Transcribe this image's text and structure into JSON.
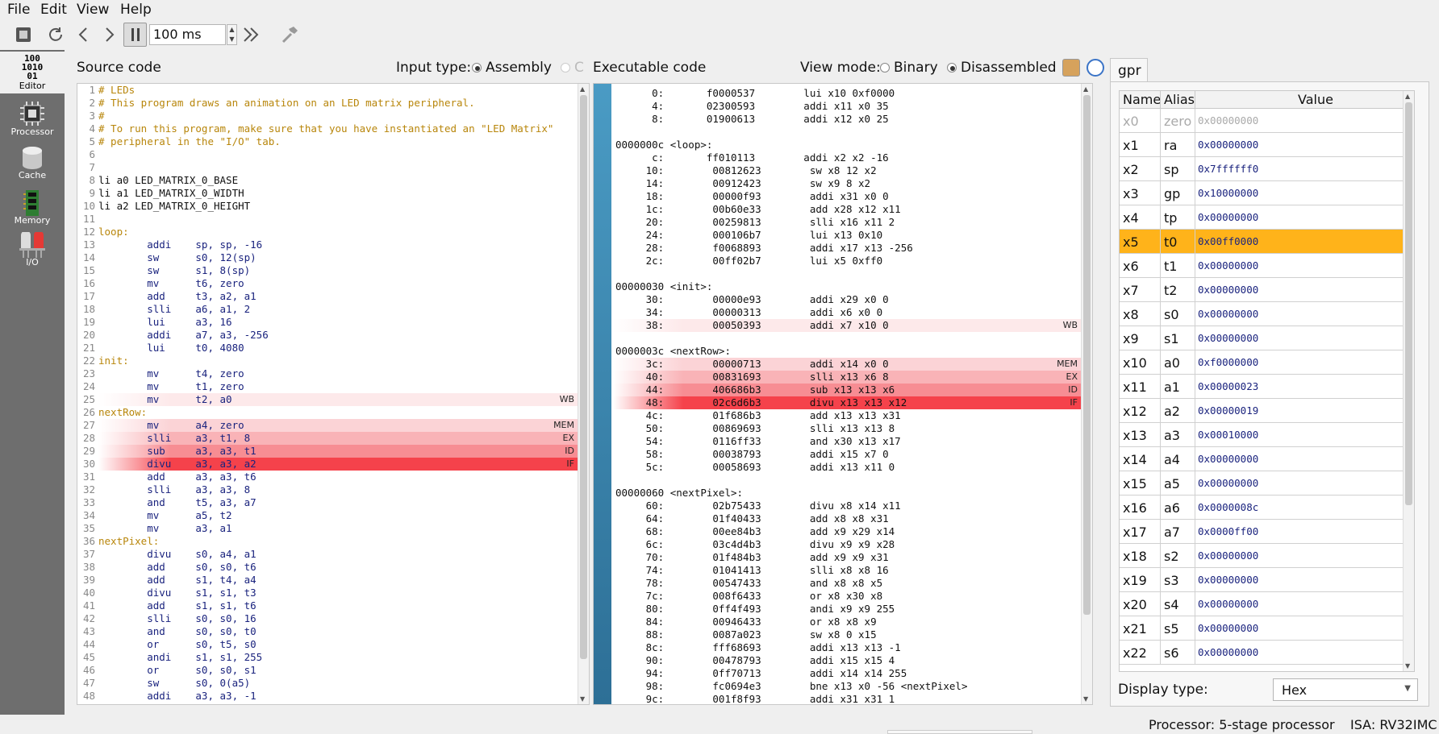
{
  "menu": [
    "File",
    "Edit",
    "View",
    "Help"
  ],
  "toolbar": {
    "speed": "100 ms"
  },
  "dock": [
    {
      "label": "Editor",
      "icon": "editor-binary-icon",
      "glyph": "100\n1010\n01"
    },
    {
      "label": "Processor",
      "icon": "processor-chip-icon"
    },
    {
      "label": "Cache",
      "icon": "cache-disk-icon"
    },
    {
      "label": "Memory",
      "icon": "memory-stick-icon"
    },
    {
      "label": "I/O",
      "icon": "io-led-icon"
    }
  ],
  "source": {
    "title": "Source code",
    "input_type_label": "Input type:",
    "opt_assembly": "Assembly",
    "opt_c": "C",
    "lines": [
      {
        "n": "1",
        "t": "# LEDs",
        "k": "comment"
      },
      {
        "n": "2",
        "t": "# This program draws an animation on an LED matrix peripheral.",
        "k": "comment"
      },
      {
        "n": "3",
        "t": "#",
        "k": "comment"
      },
      {
        "n": "4",
        "t": "# To run this program, make sure that you have instantiated an \"LED Matrix\"",
        "k": "comment"
      },
      {
        "n": "5",
        "t": "# peripheral in the \"I/O\" tab.",
        "k": "comment"
      },
      {
        "n": "6",
        "t": "",
        "k": ""
      },
      {
        "n": "7",
        "t": "",
        "k": ""
      },
      {
        "n": "8",
        "t": "li a0 LED_MATRIX_0_BASE",
        "k": "plain"
      },
      {
        "n": "9",
        "t": "li a1 LED_MATRIX_0_WIDTH",
        "k": "plain"
      },
      {
        "n": "10",
        "t": "li a2 LED_MATRIX_0_HEIGHT",
        "k": "plain"
      },
      {
        "n": "11",
        "t": "",
        "k": ""
      },
      {
        "n": "12",
        "t": "loop:",
        "k": "label"
      },
      {
        "n": "13",
        "t": "        addi    sp, sp, -16",
        "k": "instr"
      },
      {
        "n": "14",
        "t": "        sw      s0, 12(sp)",
        "k": "instr"
      },
      {
        "n": "15",
        "t": "        sw      s1, 8(sp)",
        "k": "instr"
      },
      {
        "n": "16",
        "t": "        mv      t6, zero",
        "k": "instr"
      },
      {
        "n": "17",
        "t": "        add     t3, a2, a1",
        "k": "instr"
      },
      {
        "n": "18",
        "t": "        slli    a6, a1, 2",
        "k": "instr"
      },
      {
        "n": "19",
        "t": "        lui     a3, 16",
        "k": "instr"
      },
      {
        "n": "20",
        "t": "        addi    a7, a3, -256",
        "k": "instr"
      },
      {
        "n": "21",
        "t": "        lui     t0, 4080",
        "k": "instr"
      },
      {
        "n": "22",
        "t": "init:",
        "k": "label"
      },
      {
        "n": "23",
        "t": "        mv      t4, zero",
        "k": "instr"
      },
      {
        "n": "24",
        "t": "        mv      t1, zero",
        "k": "instr"
      },
      {
        "n": "25",
        "t": "        mv      t2, a0",
        "k": "instr",
        "stage": "WB"
      },
      {
        "n": "26",
        "t": "nextRow:",
        "k": "label"
      },
      {
        "n": "27",
        "t": "        mv      a4, zero",
        "k": "instr",
        "stage": "MEM"
      },
      {
        "n": "28",
        "t": "        slli    a3, t1, 8",
        "k": "instr",
        "stage": "EX"
      },
      {
        "n": "29",
        "t": "        sub     a3, a3, t1",
        "k": "instr",
        "stage": "ID"
      },
      {
        "n": "30",
        "t": "        divu    a3, a3, a2",
        "k": "instr",
        "stage": "IF"
      },
      {
        "n": "31",
        "t": "        add     a3, a3, t6",
        "k": "instr"
      },
      {
        "n": "32",
        "t": "        slli    a3, a3, 8",
        "k": "instr"
      },
      {
        "n": "33",
        "t": "        and     t5, a3, a7",
        "k": "instr"
      },
      {
        "n": "34",
        "t": "        mv      a5, t2",
        "k": "instr"
      },
      {
        "n": "35",
        "t": "        mv      a3, a1",
        "k": "instr"
      },
      {
        "n": "36",
        "t": "nextPixel:",
        "k": "label"
      },
      {
        "n": "37",
        "t": "        divu    s0, a4, a1",
        "k": "instr"
      },
      {
        "n": "38",
        "t": "        add     s0, s0, t6",
        "k": "instr"
      },
      {
        "n": "39",
        "t": "        add     s1, t4, a4",
        "k": "instr"
      },
      {
        "n": "40",
        "t": "        divu    s1, s1, t3",
        "k": "instr"
      },
      {
        "n": "41",
        "t": "        add     s1, s1, t6",
        "k": "instr"
      },
      {
        "n": "42",
        "t": "        slli    s0, s0, 16",
        "k": "instr"
      },
      {
        "n": "43",
        "t": "        and     s0, s0, t0",
        "k": "instr"
      },
      {
        "n": "44",
        "t": "        or      s0, t5, s0",
        "k": "instr"
      },
      {
        "n": "45",
        "t": "        andi    s1, s1, 255",
        "k": "instr"
      },
      {
        "n": "46",
        "t": "        or      s0, s0, s1",
        "k": "instr"
      },
      {
        "n": "47",
        "t": "        sw      s0, 0(a5)",
        "k": "instr"
      },
      {
        "n": "48",
        "t": "        addi    a3, a3, -1",
        "k": "instr"
      }
    ]
  },
  "exec": {
    "title": "Executable code",
    "view_mode_label": "View mode:",
    "opt_binary": "Binary",
    "opt_disassembled": "Disassembled",
    "lines": [
      {
        "t": "      0:       f0000537        lui x10 0xf0000"
      },
      {
        "t": "      4:       02300593        addi x11 x0 35"
      },
      {
        "t": "      8:       01900613        addi x12 x0 25"
      },
      {
        "t": ""
      },
      {
        "t": "0000000c <loop>:"
      },
      {
        "t": "      c:       ff010113        addi x2 x2 -16"
      },
      {
        "t": "     10:        00812623        sw x8 12 x2"
      },
      {
        "t": "     14:        00912423        sw x9 8 x2"
      },
      {
        "t": "     18:        00000f93        addi x31 x0 0"
      },
      {
        "t": "     1c:        00b60e33        add x28 x12 x11"
      },
      {
        "t": "     20:        00259813        slli x16 x11 2"
      },
      {
        "t": "     24:        000106b7        lui x13 0x10"
      },
      {
        "t": "     28:        f0068893        addi x17 x13 -256"
      },
      {
        "t": "     2c:        00ff02b7        lui x5 0xff0"
      },
      {
        "t": ""
      },
      {
        "t": "00000030 <init>:"
      },
      {
        "t": "     30:        00000e93        addi x29 x0 0"
      },
      {
        "t": "     34:        00000313        addi x6 x0 0"
      },
      {
        "t": "     38:        00050393        addi x7 x10 0",
        "stage": "WB"
      },
      {
        "t": ""
      },
      {
        "t": "0000003c <nextRow>:"
      },
      {
        "t": "     3c:        00000713        addi x14 x0 0",
        "stage": "MEM"
      },
      {
        "t": "     40:        00831693        slli x13 x6 8",
        "stage": "EX"
      },
      {
        "t": "     44:        406686b3        sub x13 x13 x6",
        "stage": "ID"
      },
      {
        "t": "     48:        02c6d6b3        divu x13 x13 x12",
        "stage": "IF"
      },
      {
        "t": "     4c:        01f686b3        add x13 x13 x31"
      },
      {
        "t": "     50:        00869693        slli x13 x13 8"
      },
      {
        "t": "     54:        0116ff33        and x30 x13 x17"
      },
      {
        "t": "     58:        00038793        addi x15 x7 0"
      },
      {
        "t": "     5c:        00058693        addi x13 x11 0"
      },
      {
        "t": ""
      },
      {
        "t": "00000060 <nextPixel>:"
      },
      {
        "t": "     60:        02b75433        divu x8 x14 x11"
      },
      {
        "t": "     64:        01f40433        add x8 x8 x31"
      },
      {
        "t": "     68:        00ee84b3        add x9 x29 x14"
      },
      {
        "t": "     6c:        03c4d4b3        divu x9 x9 x28"
      },
      {
        "t": "     70:        01f484b3        add x9 x9 x31"
      },
      {
        "t": "     74:        01041413        slli x8 x8 16"
      },
      {
        "t": "     78:        00547433        and x8 x8 x5"
      },
      {
        "t": "     7c:        008f6433        or x8 x30 x8"
      },
      {
        "t": "     80:        0ff4f493        andi x9 x9 255"
      },
      {
        "t": "     84:        00946433        or x8 x8 x9"
      },
      {
        "t": "     88:        0087a023        sw x8 0 x15"
      },
      {
        "t": "     8c:        fff68693        addi x13 x13 -1"
      },
      {
        "t": "     90:        00478793        addi x15 x15 4"
      },
      {
        "t": "     94:        0ff70713        addi x14 x14 255"
      },
      {
        "t": "     98:        fc0694e3        bne x13 x0 -56 <nextPixel>"
      },
      {
        "t": "     9c:        001f8f93        addi x31 x31 1"
      }
    ]
  },
  "gpr": {
    "tab": "gpr",
    "headers": [
      "Name",
      "Alias",
      "Value"
    ],
    "rows": [
      {
        "name": "x0",
        "alias": "zero",
        "value": "0x00000000",
        "dim": true
      },
      {
        "name": "x1",
        "alias": "ra",
        "value": "0x00000000"
      },
      {
        "name": "x2",
        "alias": "sp",
        "value": "0x7ffffff0"
      },
      {
        "name": "x3",
        "alias": "gp",
        "value": "0x10000000"
      },
      {
        "name": "x4",
        "alias": "tp",
        "value": "0x00000000"
      },
      {
        "name": "x5",
        "alias": "t0",
        "value": "0x00ff0000",
        "hl": true
      },
      {
        "name": "x6",
        "alias": "t1",
        "value": "0x00000000"
      },
      {
        "name": "x7",
        "alias": "t2",
        "value": "0x00000000"
      },
      {
        "name": "x8",
        "alias": "s0",
        "value": "0x00000000"
      },
      {
        "name": "x9",
        "alias": "s1",
        "value": "0x00000000"
      },
      {
        "name": "x10",
        "alias": "a0",
        "value": "0xf0000000"
      },
      {
        "name": "x11",
        "alias": "a1",
        "value": "0x00000023"
      },
      {
        "name": "x12",
        "alias": "a2",
        "value": "0x00000019"
      },
      {
        "name": "x13",
        "alias": "a3",
        "value": "0x00010000"
      },
      {
        "name": "x14",
        "alias": "a4",
        "value": "0x00000000"
      },
      {
        "name": "x15",
        "alias": "a5",
        "value": "0x00000000"
      },
      {
        "name": "x16",
        "alias": "a6",
        "value": "0x0000008c"
      },
      {
        "name": "x17",
        "alias": "a7",
        "value": "0x0000ff00"
      },
      {
        "name": "x18",
        "alias": "s2",
        "value": "0x00000000"
      },
      {
        "name": "x19",
        "alias": "s3",
        "value": "0x00000000"
      },
      {
        "name": "x20",
        "alias": "s4",
        "value": "0x00000000"
      },
      {
        "name": "x21",
        "alias": "s5",
        "value": "0x00000000"
      },
      {
        "name": "x22",
        "alias": "s6",
        "value": "0x00000000"
      }
    ],
    "display_type_label": "Display type:",
    "display_type_value": "Hex"
  },
  "status": {
    "processor": "Processor: 5-stage processor",
    "isa": "ISA: RV32IMC"
  },
  "stage_colors": {
    "WB": "#fde9ea",
    "MEM": "#fbd3d6",
    "EX": "#f9b3b7",
    "ID": "#f78d93",
    "IF": "#f5424b"
  }
}
